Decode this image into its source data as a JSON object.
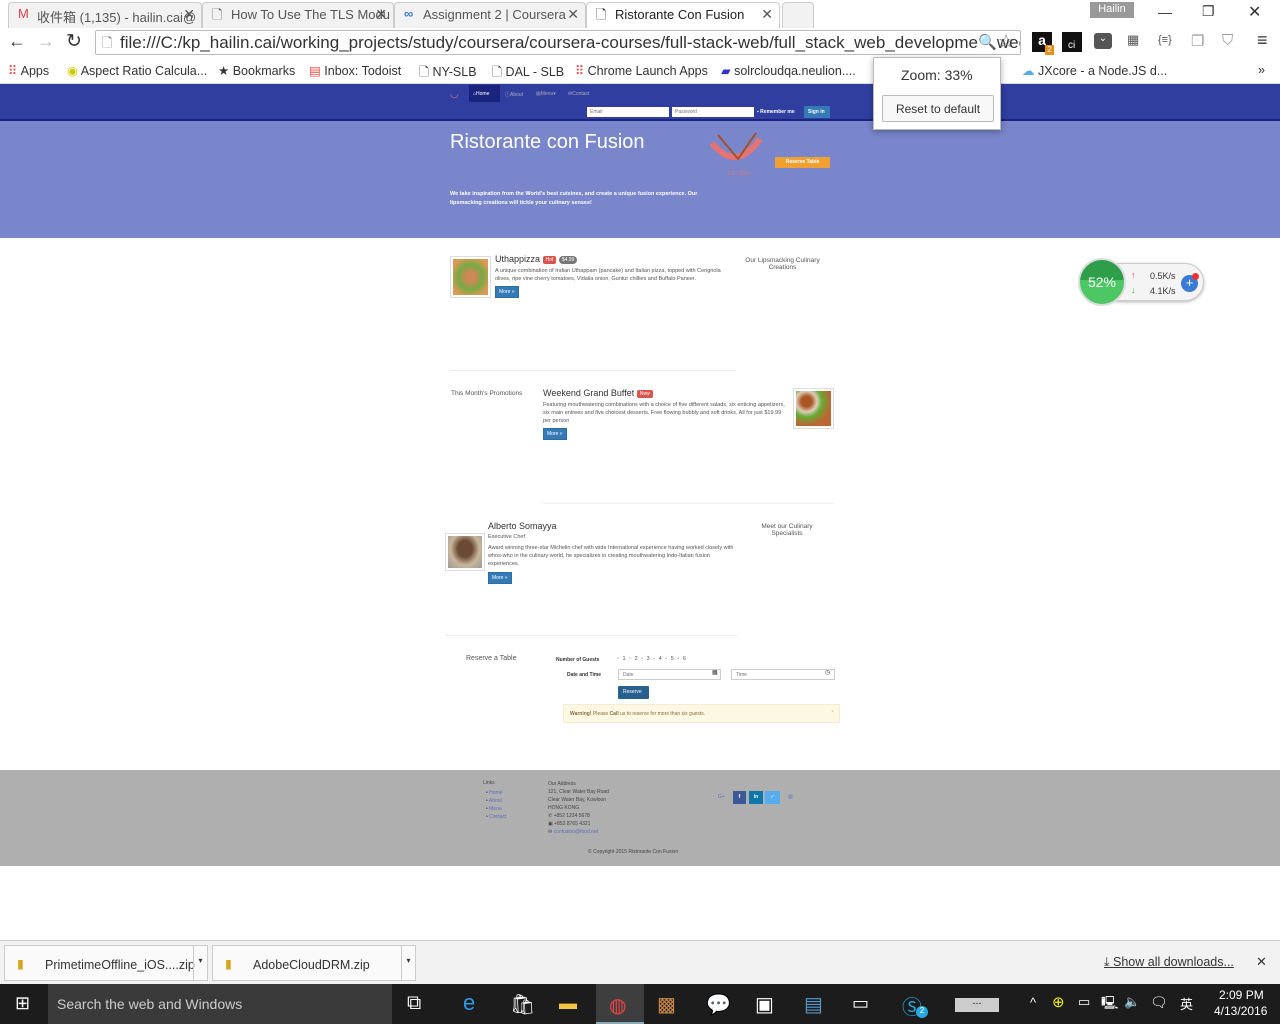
{
  "browser": {
    "tabs": [
      {
        "title": "收件箱 (1,135) - hailin.cai@",
        "icon": "gmail-icon"
      },
      {
        "title": "How To Use The TLS Modu",
        "icon": "page-icon"
      },
      {
        "title": "Assignment 2 | Coursera",
        "icon": "coursera-icon"
      },
      {
        "title": "Ristorante Con Fusion",
        "icon": "page-icon",
        "active": true
      }
    ],
    "profile": "Hailin",
    "url": "file:///C:/kp_hailin.cai/working_projects/study/coursera/coursera-courses/full-stack-web/full_stack_web_development/wee",
    "bookmarks": [
      "Apps",
      "Aspect Ratio Calcula...",
      "Bookmarks",
      "Inbox: Todoist",
      "NY-SLB",
      "DAL - SLB",
      "Chrome Launch Apps",
      "solrcloudqa.neulion....",
      "JXcore - a Node.JS d..."
    ],
    "bookmarks_more": "»",
    "zoom_popup": {
      "label": "Zoom: 33%",
      "reset": "Reset to default"
    },
    "amazon_badge": "2"
  },
  "site": {
    "nav": {
      "items": [
        "Home",
        "About",
        "Menu",
        "Contact"
      ],
      "email_placeholder": "Email",
      "password_placeholder": "Password",
      "remember": "Remember me",
      "signin": "Sign in"
    },
    "jumbotron": {
      "title": "Ristorante con Fusion",
      "text": "We take inspiration from the World's best cuisines, and create a unique fusion experience. Our lipsmacking creations will tickle your culinary senses!",
      "reserve": "Reserve Table",
      "logo_text": "Ristorante con Fusion"
    },
    "dish": {
      "name": "Uthappizza",
      "label": "Hot",
      "price": "$4.99",
      "description": "A unique combination of Indian Uthappam (pancake) and Italian pizza, topped with Cerignola olives, ripe vine cherry tomatoes, Vidalia onion, Guntur chillies and Buffalo Paneer.",
      "more": "More »",
      "side": "Our Lipsmacking Culinary Creations"
    },
    "promo": {
      "side": "This Month's Promotions",
      "name": "Weekend Grand Buffet",
      "label": "New",
      "description": "Featuring mouthwatering combinations with a choice of five different salads, six enticing appetizers, six main entrees and five choicest desserts. Free flowing bubbly and soft drinks. All for just $19.99 per person",
      "more": "More »"
    },
    "leader": {
      "name": "Alberto Somayya",
      "title": "Executive Chef",
      "description": "Award winning three-star Michelin chef with wide International experience having worked closely with whos-who in the culinary world, he specializes in creating mouthwatering Indo-Italian fusion experiences.",
      "more": "More »",
      "side": "Meet our Culinary Specialists"
    },
    "reserve": {
      "title": "Reserve a Table",
      "guests_label": "Number of Guests",
      "guests": [
        "1",
        "2",
        "3",
        "4",
        "5",
        "6"
      ],
      "datetime_label": "Date and Time",
      "date_placeholder": "Date",
      "time_placeholder": "Time",
      "button": "Reserve",
      "warning_strong": "Warning!",
      "warning_text1": "Please",
      "warning_call": "Call",
      "warning_text2": "us to reserve for more than six guests.",
      "close": "×"
    },
    "footer": {
      "links_title": "Links",
      "links": [
        "Home",
        "About",
        "Menu",
        "Contact"
      ],
      "address_title": "Our Address",
      "address": [
        "121, Clear Water Bay Road",
        "Clear Water Bay, Kowloon",
        "HONG KONG"
      ],
      "phone": "+852 1234 5678",
      "fax": "+852 8765 4321",
      "email": "confusion@food.net",
      "copyright": "© Copyright 2015 Ristorante Con Fusion"
    }
  },
  "speed_widget": {
    "percent": "52%",
    "up": "0.5K/s",
    "down": "4.1K/s"
  },
  "downloads": {
    "items": [
      "PrimetimeOffline_iOS....zip",
      "AdobeCloudDRM.zip"
    ],
    "show_all": "Show all downloads..."
  },
  "taskbar": {
    "search": "Search the web and Windows",
    "time": "2:09 PM",
    "date": "4/13/2016",
    "skype_badge": "2"
  },
  "colors": {
    "navbar": "#303f9f",
    "jumbotron": "#7986cb",
    "reserve_button": "#f0a030",
    "footer": "#afafaf",
    "label_danger": "#d9534f",
    "primary": "#337ab7"
  }
}
